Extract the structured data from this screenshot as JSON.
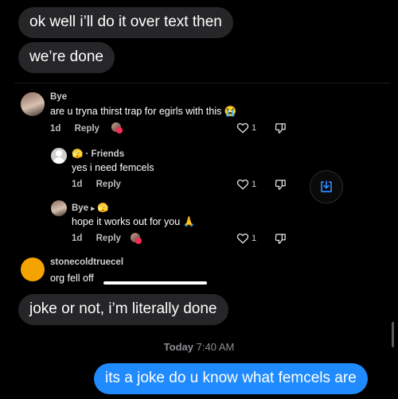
{
  "messages": {
    "m1": "ok well i’ll do it over text then",
    "m2": "we’re done",
    "m3": "joke or not, i’m literally done",
    "m4": "its a joke do u know what femcels are"
  },
  "timestamp": {
    "day": "Today",
    "time": "7:40 AM"
  },
  "screenshot": {
    "c1": {
      "username": "Bye",
      "text": "are u tryna thirst trap for egirls with this",
      "emoji": "😭",
      "age": "1d",
      "reply": "Reply",
      "likes": "1"
    },
    "c2": {
      "prefix_emoji": "🫣",
      "audience": "· Friends",
      "text": "yes i need femcels",
      "age": "1d",
      "reply": "Reply",
      "likes": "1"
    },
    "c3": {
      "username": "Bye",
      "arrow": "▸",
      "tag_emoji": "🫣",
      "text": "hope it works out for you",
      "emoji": "🙏",
      "age": "1d",
      "reply": "Reply",
      "likes": "1"
    },
    "c4": {
      "username": "stonecoldtruecel",
      "text": "org fell off"
    }
  },
  "icons": [
    "heart-outline-icon",
    "thumbs-down-icon",
    "download-icon"
  ],
  "colors": {
    "outgoing": "#1f8bff",
    "incoming": "#262629",
    "background": "#000000",
    "download": "#2e8bff"
  }
}
